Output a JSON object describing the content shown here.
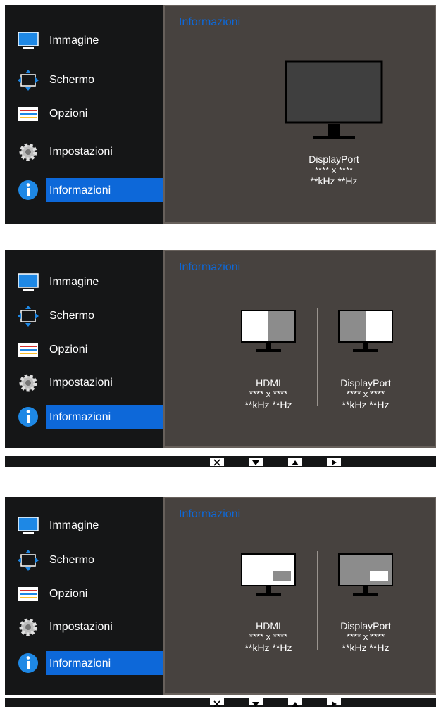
{
  "menu": {
    "items": [
      {
        "label": "Immagine",
        "icon": "monitor-icon"
      },
      {
        "label": "Schermo",
        "icon": "move-arrows-icon"
      },
      {
        "label": "Opzioni",
        "icon": "sliders-icon"
      },
      {
        "label": "Impostazioni",
        "icon": "gear-icon"
      },
      {
        "label": "Informazioni",
        "icon": "info-icon",
        "selected": true
      }
    ]
  },
  "title": "Informazioni",
  "panels": [
    {
      "sources": [
        {
          "name": "DisplayPort",
          "resolution": "**** x ****",
          "frequency": "**kHz **Hz"
        }
      ]
    },
    {
      "sources": [
        {
          "name": "HDMI",
          "resolution": "**** x ****",
          "frequency": "**kHz **Hz"
        },
        {
          "name": "DisplayPort",
          "resolution": "**** x ****",
          "frequency": "**kHz **Hz"
        }
      ]
    },
    {
      "sources": [
        {
          "name": "HDMI",
          "resolution": "**** x ****",
          "frequency": "**kHz **Hz"
        },
        {
          "name": "DisplayPort",
          "resolution": "**** x ****",
          "frequency": "**kHz **Hz"
        }
      ]
    }
  ],
  "nav_buttons": [
    "close-icon",
    "down-arrow-icon",
    "up-arrow-icon",
    "right-arrow-icon"
  ],
  "colors": {
    "accent": "#0d68d9",
    "sidebar": "#151617",
    "content": "#47423f"
  }
}
